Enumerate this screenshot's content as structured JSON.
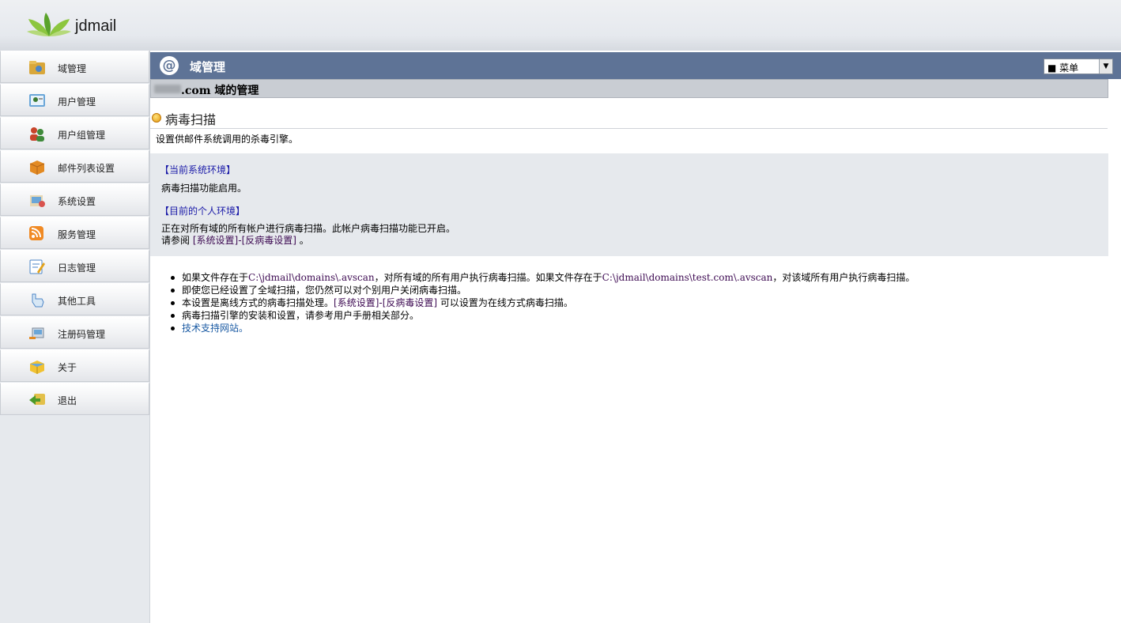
{
  "app": {
    "brand": "jdmail"
  },
  "sidebar": {
    "items": [
      {
        "label": "域管理"
      },
      {
        "label": "用户管理"
      },
      {
        "label": "用户组管理"
      },
      {
        "label": "邮件列表设置"
      },
      {
        "label": "系统设置"
      },
      {
        "label": "服务管理"
      },
      {
        "label": "日志管理"
      },
      {
        "label": "其他工具"
      },
      {
        "label": "注册码管理"
      },
      {
        "label": "关于"
      },
      {
        "label": "退出"
      }
    ]
  },
  "header": {
    "title": "域管理",
    "menu_select": "■ 菜单",
    "domain_suffix": ".com 域的管理"
  },
  "section": {
    "title": "病毒扫描",
    "description": "设置供邮件系统调用的杀毒引擎。"
  },
  "env": {
    "system_heading": "【当前系统环境】",
    "system_text": "病毒扫描功能启用。",
    "personal_heading": "【目前的个人环境】",
    "personal_text": "正在对所有域的所有帐户进行病毒扫描。此帐户病毒扫描功能已开启。",
    "see_prefix": "请参阅",
    "see_link_1": "[系统设置]",
    "see_dash": "-",
    "see_link_2": "[反病毒设置]",
    "see_suffix": "。"
  },
  "notes": {
    "n1_a": "如果文件存在于",
    "n1_path1": "C:\\jdmail\\domains\\.avscan",
    "n1_b": "，对所有域的所有用户执行病毒扫描。如果文件存在于",
    "n1_path2": "C:\\jdmail\\domains\\test.com\\.avscan",
    "n1_c": "，对该域所有用户执行病毒扫描。",
    "n2": "即使您已经设置了全域扫描，您仍然可以对个别用户关闭病毒扫描。",
    "n3_a": "本设置是离线方式的病毒扫描处理。",
    "n3_link1": "[系统设置]",
    "n3_dash": "-",
    "n3_link2": "[反病毒设置]",
    "n3_b": " 可以设置为在线方式病毒扫描。",
    "n4": "病毒扫描引擎的安装和设置，请参考用户手册相关部分。",
    "n5": "技术支持网站。"
  },
  "colors": {
    "title_bar": "#5e7396",
    "link": "#1a5aa3",
    "heading": "#1a1aa8"
  }
}
